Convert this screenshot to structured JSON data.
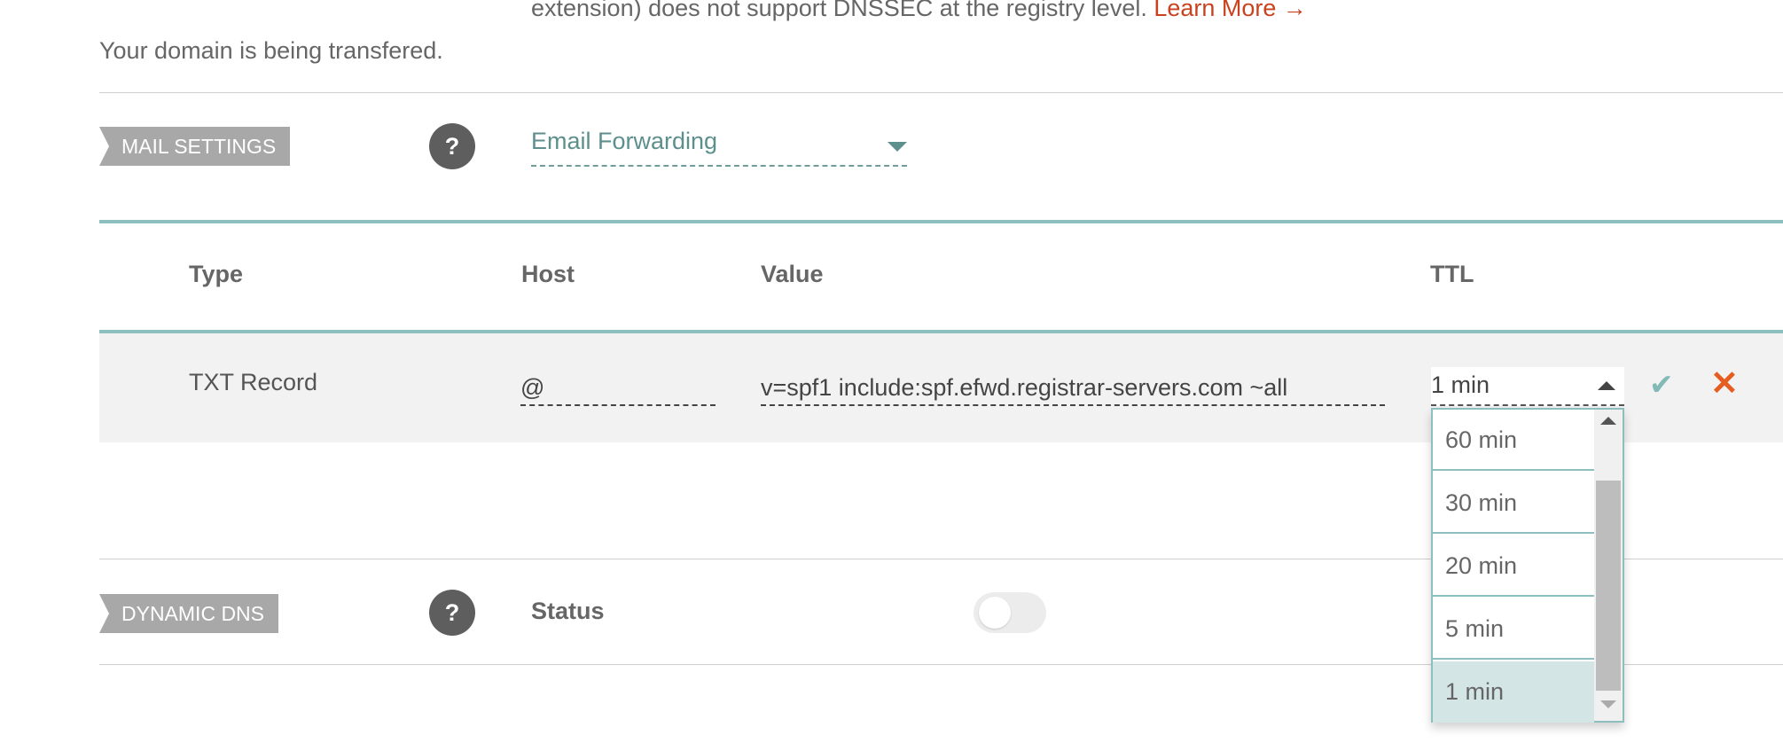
{
  "notice": {
    "text": "extension) does not support DNSSEC at the registry level.",
    "link_label": "Learn More →"
  },
  "transfer_message": "Your domain is being transfered.",
  "mail_settings": {
    "tag": "MAIL SETTINGS",
    "help_label": "?",
    "selected_option": "Email Forwarding"
  },
  "table": {
    "headers": {
      "type": "Type",
      "host": "Host",
      "value": "Value",
      "ttl": "TTL"
    },
    "row": {
      "type": "TXT Record",
      "host": "@",
      "value": "v=spf1 include:spf.efwd.registrar-servers.com ~all",
      "ttl": "1 min"
    }
  },
  "ttl_options": [
    "60 min",
    "30 min",
    "20 min",
    "5 min",
    "1 min"
  ],
  "ttl_selected_index": 4,
  "dynamic_dns": {
    "tag": "DYNAMIC DNS",
    "help_label": "?",
    "status_label": "Status",
    "status_enabled": false
  },
  "icons": {
    "confirm": "check-icon",
    "cancel": "close-icon"
  },
  "colors": {
    "accent": "#8cbfbd",
    "link": "#c9421f",
    "cancel": "#e65d21"
  }
}
